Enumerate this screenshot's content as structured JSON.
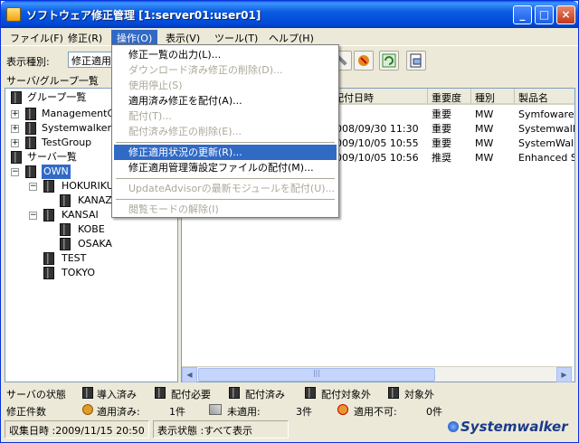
{
  "window": {
    "title": "ソフトウェア修正管理  [1:server01:user01]",
    "buttons": [
      "_",
      "□",
      "×"
    ]
  },
  "menubar": {
    "items": [
      "ファイル(F)",
      "修正(R)",
      "操作(O)",
      "表示(V)",
      "ツール(T)",
      "ヘルプ(H)"
    ]
  },
  "toolbar": {
    "display_type_label": "表示種別:",
    "display_type_value": "修正適用",
    "server_group_label": "サーバ/グループ一覧"
  },
  "tree": {
    "group_root": "グループ一覧",
    "groups": [
      "ManagementGr",
      "Systemwalker",
      "TestGroup"
    ],
    "server_root": "サーバ一覧",
    "nodes": [
      "OWN",
      "HOKURIKU",
      "KANAZ",
      "KANSAI",
      "KOBE",
      "OSAKA",
      "TEST",
      "TOKYO"
    ]
  },
  "table": {
    "columns": [
      "配付日時",
      "重要度",
      "種別",
      "製品名"
    ],
    "rows": [
      {
        "date": "",
        "severity": "重要",
        "kind": "MW",
        "product": "Symfoware"
      },
      {
        "date": "008/09/30 11:30",
        "severity": "重要",
        "kind": "MW",
        "product": "Systemwalk"
      },
      {
        "date": "009/10/05 10:55",
        "severity": "重要",
        "kind": "MW",
        "product": "SystemWall"
      },
      {
        "date": "009/10/05 10:56",
        "severity": "推奨",
        "kind": "MW",
        "product": "Enhanced S"
      }
    ]
  },
  "dropdown": {
    "items": [
      {
        "label": "修正一覧の出力(L)...",
        "enabled": true
      },
      {
        "label": "ダウンロード済み修正の削除(D)...",
        "enabled": false
      },
      {
        "label": "使用停止(S)",
        "enabled": false
      },
      {
        "label": "適用済み修正を配付(A)...",
        "enabled": true
      },
      {
        "label": "配付(T)...",
        "enabled": false
      },
      {
        "label": "配付済み修正の削除(E)...",
        "enabled": false
      },
      {
        "label": "修正適用状況の更新(R)...",
        "enabled": true,
        "highlight": true
      },
      {
        "label": "修正適用管理簿設定ファイルの配付(M)...",
        "enabled": true
      },
      {
        "label": "UpdateAdvisorの最新モジュールを配付(U)...",
        "enabled": false
      },
      {
        "label": "閲覧モードの解除(I)",
        "enabled": false
      }
    ]
  },
  "legend": {
    "title": "サーバの状態",
    "items": [
      "導入済み",
      "配付必要",
      "配付済み",
      "配付対象外",
      "対象外"
    ]
  },
  "counts": {
    "title": "修正件数",
    "applied_label": "適用済み:",
    "applied_value": "1件",
    "not_applied_label": "未適用:",
    "not_applied_value": "3件",
    "not_applicable_label": "適用不可:",
    "not_applicable_value": "0件"
  },
  "status": {
    "collected": "収集日時 :2009/11/15 20:50",
    "state": "表示状態 :すべて表示"
  },
  "brand": "Systemwalker",
  "colors": {
    "titlebar": "#0a5ce0",
    "selection": "#316ac5"
  }
}
